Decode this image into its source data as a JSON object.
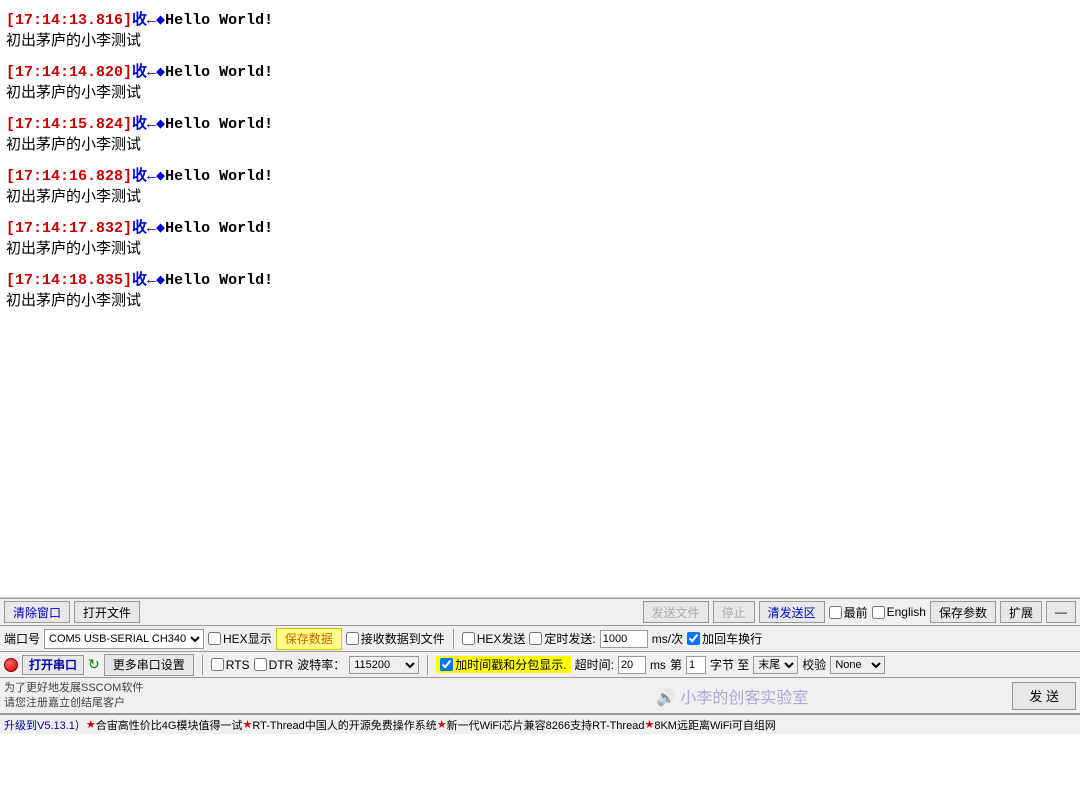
{
  "terminal": {
    "entries": [
      {
        "timestamp": "[17:14:13.816]",
        "direction": "收←◆",
        "message": "Hello World!",
        "chinese": "初出茅庐的小李测试"
      },
      {
        "timestamp": "[17:14:14.820]",
        "direction": "收←◆",
        "message": "Hello World!",
        "chinese": "初出茅庐的小李测试"
      },
      {
        "timestamp": "[17:14:15.824]",
        "direction": "收←◆",
        "message": "Hello World!",
        "chinese": "初出茅庐的小李测试"
      },
      {
        "timestamp": "[17:14:16.828]",
        "direction": "收←◆",
        "message": "Hello World!",
        "chinese": "初出茅庐的小李测试"
      },
      {
        "timestamp": "[17:14:17.832]",
        "direction": "收←◆",
        "message": "Hello World!",
        "chinese": "初出茅庐的小李测试"
      },
      {
        "timestamp": "[17:14:18.835]",
        "direction": "收←◆",
        "message": "Hello World!",
        "chinese": "初出茅庐的小李测试"
      }
    ]
  },
  "toolbar1": {
    "clear_window": "清除窗口",
    "open_file": "打开文件",
    "send_file": "发送文件",
    "stop": "停止",
    "clear_send": "清发送区",
    "last_checkbox": "最前",
    "english_checkbox": "English",
    "save_params": "保存参数",
    "expand": "扩展",
    "minus": "—"
  },
  "toolbar2": {
    "port_label": "端口号",
    "port_value": "COM5 USB-SERIAL CH340",
    "hex_display": "HEX显示",
    "save_data": "保存数据",
    "receive_to_file": "接收数据到文件",
    "hex_send": "HEX发送",
    "timed_send": "定时发送:",
    "interval_value": "1000",
    "interval_unit": "ms/次",
    "add_return": "加回车换行"
  },
  "toolbar3": {
    "rts": "RTS",
    "dtr": "DTR",
    "baud_label": "波特率：",
    "baud_value": "115200",
    "more_ports": "更多串口设置",
    "add_timestamp": "加时间戳和分包显示.",
    "timeout_label": "超时间:",
    "timeout_value": "20",
    "timeout_unit": "ms",
    "byte_label": "第",
    "byte_value": "1",
    "byte_unit": "字节 至",
    "end_label": "末尾",
    "checksum_label": "校验",
    "checksum_value": "None"
  },
  "send_area": {
    "user_info": "为了更好地发展SSCOM软件\n请您注册嘉立创结尾客户",
    "send_btn": "发 送"
  },
  "watermark": "🔊 小李的创客实验室",
  "statusbar": {
    "upgrade": "升级到V5.13.1",
    "items": [
      "★合宙高性价比4G模块值得一试",
      "★RT-Thread中国人的开源免费操作系统",
      "★新一代WiFi芯片兼容8266支持RT-Thread",
      "★8KM远距离WiFi可自组网"
    ]
  }
}
